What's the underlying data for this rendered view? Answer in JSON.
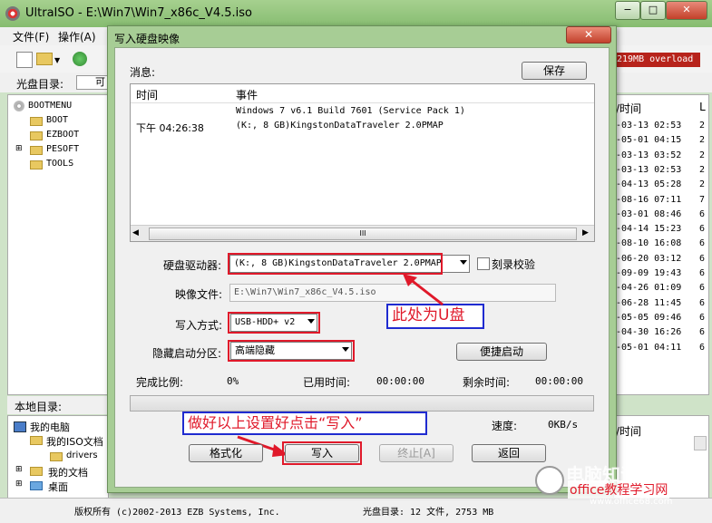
{
  "app": {
    "title": "UltraISO - E:\\Win7\\Win7_x86c_V4.5.iso"
  },
  "window_buttons": {
    "minimize": "−",
    "maximize": "□",
    "close": "✕"
  },
  "menu": [
    "文件(F)",
    "操作(A)"
  ],
  "toolbar": {
    "overload_text": "219MB overload"
  },
  "cd_bar": {
    "label": "光盘目录:",
    "input_value": "可"
  },
  "tree": [
    "BOOTMENU",
    "BOOT",
    "EZBOOT",
    "PESOFT",
    "TOOLS"
  ],
  "local_dir": {
    "label": "本地目录:",
    "items": [
      "我的电脑",
      "我的ISO文档",
      "drivers",
      "我的文档",
      "桌面"
    ]
  },
  "right_list": {
    "header": "/时间",
    "header2": "L",
    "rows": [
      [
        "-03-13 02:53",
        "2"
      ],
      [
        "-05-01 04:15",
        "2"
      ],
      [
        "-03-13 03:52",
        "2"
      ],
      [
        "-03-13 02:53",
        "2"
      ],
      [
        "-04-13 05:28",
        "2"
      ],
      [
        "-08-16 07:11",
        "7"
      ],
      [
        "-03-01 08:46",
        "6"
      ],
      [
        "-04-14 15:23",
        "6"
      ],
      [
        "-08-10 16:08",
        "6"
      ],
      [
        "-06-20 03:12",
        "6"
      ],
      [
        "-09-09 19:43",
        "6"
      ],
      [
        "-04-26 01:09",
        "6"
      ],
      [
        "-06-28 11:45",
        "6"
      ],
      [
        "-05-05 09:46",
        "6"
      ],
      [
        "-04-30 16:26",
        "6"
      ],
      [
        "-05-01 04:11",
        "6"
      ]
    ],
    "lower_header": "/时间"
  },
  "statusbar": {
    "copyright": "版权所有 (c)2002-2013 EZB Systems, Inc.",
    "cd_info": "光盘目录: 12 文件, 2753 MB"
  },
  "dialog": {
    "title": "写入硬盘映像",
    "close": "✕",
    "messages_label": "消息:",
    "save_button": "保存",
    "columns": [
      "时间",
      "事件"
    ],
    "log": [
      {
        "time": "",
        "event": "Windows 7 v6.1 Build 7601 (Service Pack 1)"
      },
      {
        "time": "下午 04:26:38",
        "event": "(K:, 8 GB)KingstonDataTraveler 2.0PMAP"
      }
    ],
    "scroll_grip": "III",
    "drive_label": "硬盘驱动器:",
    "drive_value": "(K:, 8 GB)KingstonDataTraveler 2.0PMAP",
    "verify_label": "刻录校验",
    "image_label": "映像文件:",
    "image_value": "E:\\Win7\\Win7_x86c_V4.5.iso",
    "method_label": "写入方式:",
    "method_value": "USB-HDD+ v2",
    "hidden_label": "隐藏启动分区:",
    "hidden_value": "高端隐藏",
    "quick_boot_button": "便捷启动",
    "ratio_label": "完成比例:",
    "ratio_value": "0%",
    "elapsed_label": "已用时间:",
    "elapsed_value": "00:00:00",
    "remaining_label": "剩余时间:",
    "remaining_value": "00:00:00",
    "progress": 0,
    "speed_label": "速度:",
    "speed_value": "0KB/s",
    "format_button": "格式化",
    "write_button": "写入",
    "abort_button": "终止[A]",
    "back_button": "返回"
  },
  "annotations": {
    "callout_usb": "此处为U盘",
    "callout_write": "做好以上设置好点击“写入”"
  },
  "watermark": {
    "line1": "电脑知识学习网",
    "line2": "office教程学习网",
    "line3": "www.office68.com"
  },
  "colors": {
    "titlebar": "#96c57e",
    "highlight_red": "#e0192a",
    "callout_blue": "#1f2bd0",
    "overload_bg": "#b7231b"
  }
}
